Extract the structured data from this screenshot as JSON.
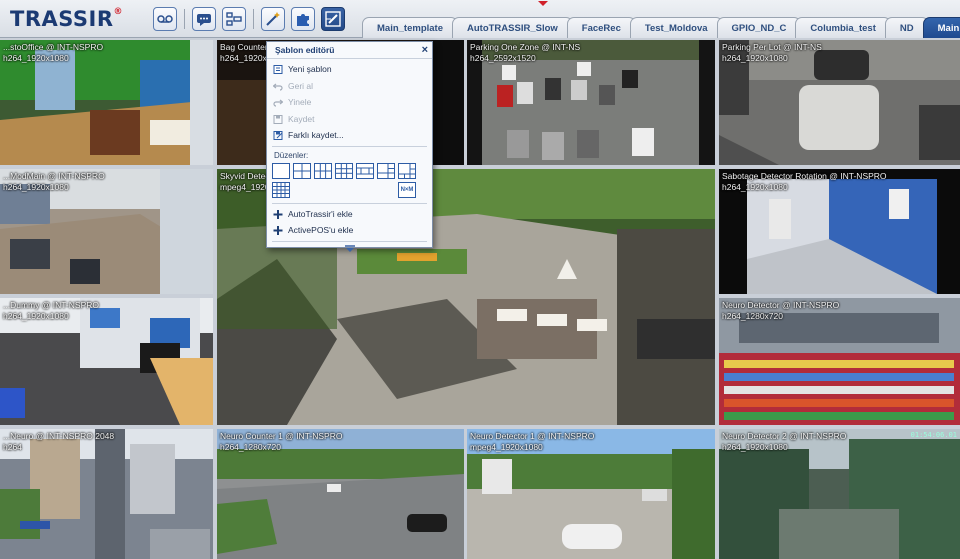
{
  "app": {
    "logo": "TRASSIR",
    "logo_mark": "®"
  },
  "toolbar": {
    "buttons": [
      "tape-icon",
      "chat-icon",
      "layout-editor-icon",
      "magic-wand-icon",
      "puzzle-icon",
      "template-edit-icon"
    ]
  },
  "tabs": [
    "Main_template",
    "AutoTRASSIR_Slow",
    "FaceRec",
    "Test_Moldova",
    "GPIO_ND_C",
    "Columbia_test",
    "ND",
    "Main"
  ],
  "active_tab": "Main",
  "cameras": [
    {
      "name": "...stoOffice @ INT-NSPRO",
      "info": "h264_1920x1080"
    },
    {
      "name": "Bag Counter",
      "info": "h264_1920x..."
    },
    {
      "name": "Parking One Zone @ INT-NS",
      "info": "h264_2592x1520"
    },
    {
      "name": "Parking Per Lot @ INT-NS",
      "info": "h264_1920x1080"
    },
    {
      "name": "...ModMain @ INT-NSPRO",
      "info": "h264_1920x1080"
    },
    {
      "name": "Sabotage Detector Rotation @ INT-NSPRO",
      "info": "h264_1920x1080"
    },
    {
      "name": "Skyvid Detector",
      "info": "mpeg4_1920x..."
    },
    {
      "name": "...Dummy @ INT-NSPRO",
      "info": "h264_1920x1080"
    },
    {
      "name": "Neuro Detector @ INT-NSPRO",
      "info": "h264_1280x720"
    },
    {
      "name": "...Neuro @ INT-NSPRO 2048",
      "info": "h264"
    },
    {
      "name": "Neuro Counter 1 @ INT-NSPRO",
      "info": "h264_1280x720"
    },
    {
      "name": "Neuro Detector 1 @ INT-NSPRO",
      "info": "mpeg4_1920x1080"
    },
    {
      "name": "Neuro Detector 2 @ INT-NSPRO",
      "info": "h264_1920x1080"
    }
  ],
  "timestamp": "01:54:06.01",
  "editor": {
    "title": "Şablon editörü",
    "close": "×",
    "items": [
      {
        "label": "Yeni şablon",
        "icon": "new-template-icon",
        "enabled": true
      },
      {
        "label": "Geri al",
        "icon": "undo-icon",
        "enabled": false
      },
      {
        "label": "Yinele",
        "icon": "redo-icon",
        "enabled": false
      },
      {
        "label": "Kaydet",
        "icon": "save-icon",
        "enabled": false
      },
      {
        "label": "Farklı kaydet...",
        "icon": "save-as-icon",
        "enabled": true
      }
    ],
    "layouts_label": "Düzenler:",
    "custom_layout_label": "N×M",
    "add_items": [
      {
        "label": "AutoTrassir'i ekle",
        "icon": "plus-icon"
      },
      {
        "label": "ActivePOS'u ekle",
        "icon": "plus-icon"
      }
    ],
    "more_icon": "expand-down-icon"
  }
}
